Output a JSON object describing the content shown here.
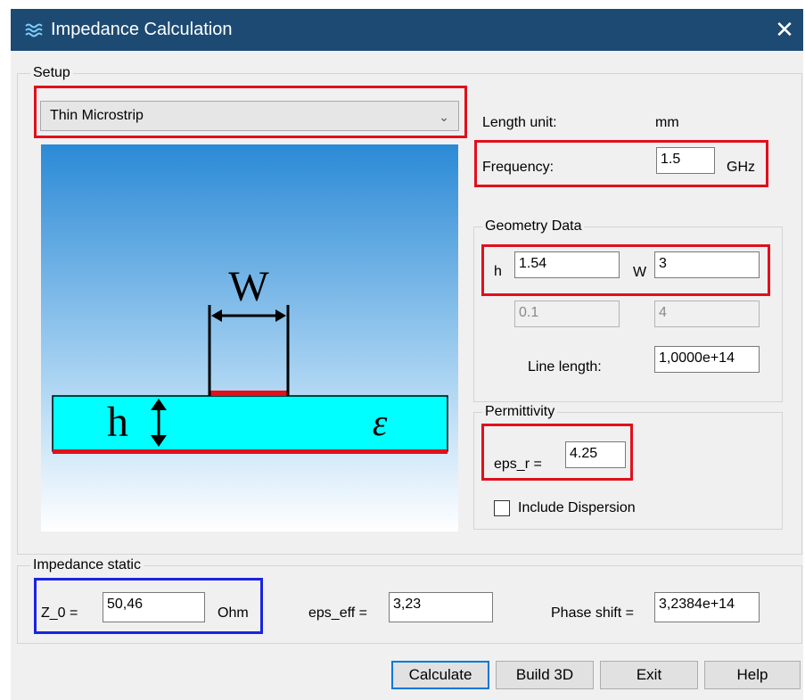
{
  "window": {
    "title": "Impedance Calculation",
    "close_glyph": "✕"
  },
  "setup": {
    "group_label": "Setup",
    "line_type": "Thin Microstrip",
    "diagram": {
      "w_label": "W",
      "h_label": "h",
      "eps_label": "ε"
    },
    "length_unit_label": "Length unit:",
    "length_unit_value": "mm",
    "frequency_label": "Frequency:",
    "frequency_value": "1.5",
    "frequency_unit": "GHz"
  },
  "geometry": {
    "group_label": "Geometry Data",
    "h_label": "h",
    "h_value": "1.54",
    "w_label": "W",
    "w_value": "3",
    "disabled_1": "0.1",
    "disabled_2": "4",
    "line_length_label": "Line length:",
    "line_length_value": "1,0000e+14"
  },
  "permittivity": {
    "group_label": "Permittivity",
    "eps_r_label": "eps_r =",
    "eps_r_value": "4.25",
    "dispersion_label": "Include Dispersion",
    "dispersion_checked": false
  },
  "impedance": {
    "group_label": "Impedance static",
    "z0_label": "Z_0 =",
    "z0_value": "50,46",
    "z0_unit": "Ohm",
    "eps_eff_label": "eps_eff =",
    "eps_eff_value": "3,23",
    "phase_label": "Phase shift =",
    "phase_value": "3,2384e+14"
  },
  "buttons": {
    "calculate": "Calculate",
    "build3d": "Build 3D",
    "exit": "Exit",
    "help": "Help"
  },
  "colors": {
    "title_bar": "#1d4a73",
    "highlight_red": "#e0101c",
    "highlight_blue": "#1a24e0",
    "substrate": "#00ffff",
    "strip": "#e0101c"
  }
}
